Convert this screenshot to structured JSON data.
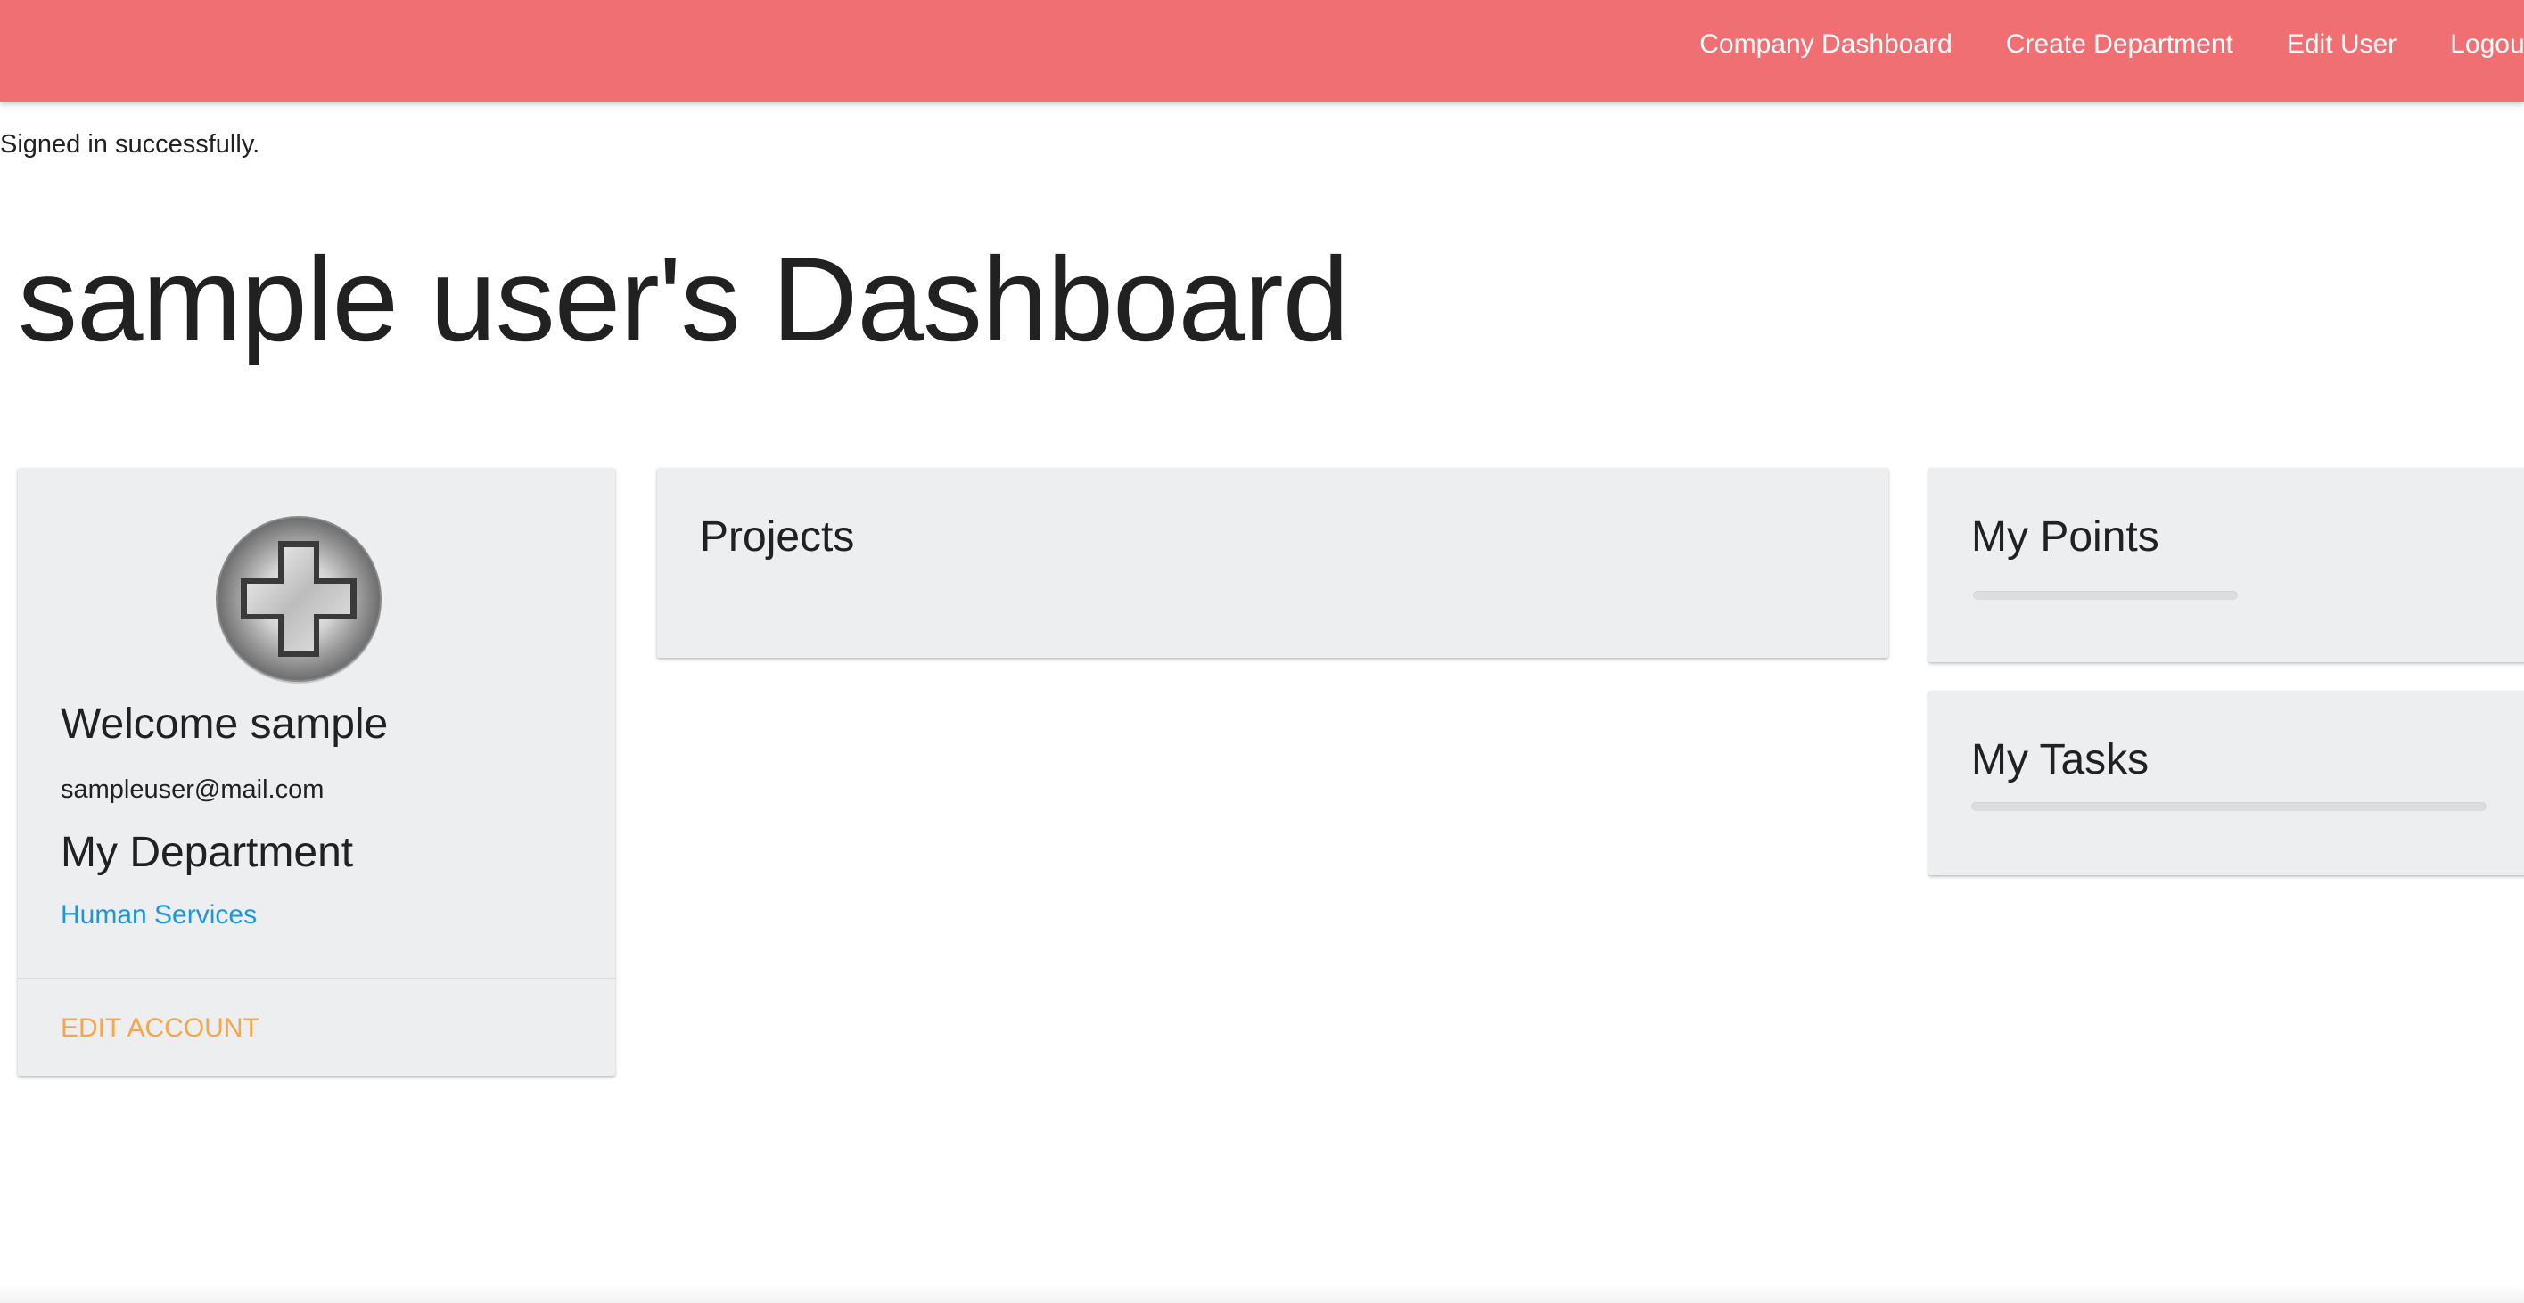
{
  "nav": {
    "links": [
      "Company Dashboard",
      "Create Department",
      "Edit User",
      "Logout"
    ],
    "background_color": "#ef6f73"
  },
  "flash": {
    "message": "Signed in successfully."
  },
  "page": {
    "title": "sample user's Dashboard"
  },
  "profile": {
    "avatar_icon": "silver-cross-badge-icon",
    "welcome": "Welcome sample",
    "email": "sampleuser@mail.com",
    "department_heading": "My Department",
    "department_name": "Human Services",
    "edit_account_label": "EDIT ACCOUNT"
  },
  "projects": {
    "title": "Projects"
  },
  "points": {
    "title": "My Points",
    "progress": 0
  },
  "tasks": {
    "title": "My Tasks",
    "progress": 0
  },
  "colors": {
    "link": "#2196d6",
    "action": "#f5a54a",
    "card_background": "#edeef0"
  }
}
